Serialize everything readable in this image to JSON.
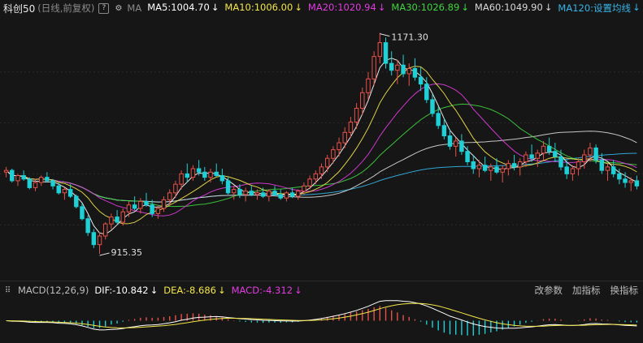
{
  "header": {
    "symbol": "科创50",
    "period_note": "(日线,前复权)",
    "help_icon": "help-icon",
    "settings_icon": "gear-icon",
    "ma_label": "MA",
    "mas": [
      {
        "key": "ma5",
        "label": "MA5:1004.70",
        "color": "#ffffff",
        "arrow": "↓"
      },
      {
        "key": "ma10",
        "label": "MA10:1006.00",
        "color": "#f3e64a",
        "arrow": "↓"
      },
      {
        "key": "ma20",
        "label": "MA20:1020.94",
        "color": "#e03ce0",
        "arrow": "↓"
      },
      {
        "key": "ma30",
        "label": "MA30:1026.89",
        "color": "#3fd43f",
        "arrow": "↓"
      },
      {
        "key": "ma60",
        "label": "MA60:1049.90",
        "color": "#d8d8d8",
        "arrow": "↓"
      },
      {
        "key": "ma120",
        "label": "MA120:设置均线",
        "color": "#35b5e8",
        "arrow": "↓"
      }
    ]
  },
  "macd_header": {
    "collapse_icon": "grid-dots-icon",
    "label": "MACD(12,26,9)",
    "dif": "DIF:-10.842",
    "dea": "DEA:-8.686",
    "macd": "MACD:-4.312",
    "arrow": "↓",
    "links": [
      "改参数",
      "加指标",
      "换指标"
    ]
  },
  "colors": {
    "up": "#e8514a",
    "down": "#1fd0d6",
    "dif": "#ffffff",
    "dea": "#f3e64a",
    "macd_label": "#e03ce0"
  },
  "chart_data": {
    "type": "candlestick",
    "ylim": [
      890,
      1185
    ],
    "high_label": "1171.30",
    "low_label": "915.35",
    "high_value": 1171.3,
    "low_value": 915.35,
    "ohlc": [
      [
        1010,
        1016,
        1004,
        1012
      ],
      [
        1012,
        1014,
        998,
        1000
      ],
      [
        1000,
        1008,
        994,
        1006
      ],
      [
        1006,
        1012,
        1000,
        1002
      ],
      [
        1002,
        1004,
        990,
        992
      ],
      [
        992,
        1002,
        988,
        998
      ],
      [
        998,
        1006,
        994,
        1004
      ],
      [
        1004,
        1010,
        998,
        1000
      ],
      [
        1000,
        1002,
        990,
        994
      ],
      [
        994,
        998,
        984,
        986
      ],
      [
        986,
        992,
        978,
        990
      ],
      [
        990,
        996,
        980,
        982
      ],
      [
        982,
        984,
        968,
        970
      ],
      [
        970,
        974,
        954,
        956
      ],
      [
        956,
        960,
        936,
        940
      ],
      [
        940,
        944,
        922,
        926
      ],
      [
        926,
        940,
        915.35,
        936
      ],
      [
        936,
        952,
        932,
        950
      ],
      [
        950,
        962,
        944,
        958
      ],
      [
        958,
        966,
        950,
        952
      ],
      [
        952,
        968,
        948,
        964
      ],
      [
        964,
        976,
        958,
        972
      ],
      [
        972,
        982,
        966,
        968
      ],
      [
        968,
        980,
        962,
        976
      ],
      [
        976,
        986,
        970,
        972
      ],
      [
        972,
        978,
        958,
        962
      ],
      [
        962,
        972,
        956,
        968
      ],
      [
        968,
        982,
        964,
        978
      ],
      [
        978,
        990,
        972,
        986
      ],
      [
        986,
        1000,
        980,
        996
      ],
      [
        996,
        1012,
        990,
        1008
      ],
      [
        1008,
        1020,
        998,
        1004
      ],
      [
        1004,
        1018,
        1000,
        1014
      ],
      [
        1014,
        1024,
        1006,
        1010
      ],
      [
        1010,
        1016,
        1000,
        1004
      ],
      [
        1004,
        1014,
        998,
        1010
      ],
      [
        1010,
        1020,
        1004,
        1006
      ],
      [
        1006,
        1014,
        996,
        1000
      ],
      [
        1000,
        1004,
        984,
        986
      ],
      [
        986,
        994,
        978,
        990
      ],
      [
        990,
        996,
        980,
        984
      ],
      [
        984,
        992,
        976,
        988
      ],
      [
        988,
        994,
        982,
        984
      ],
      [
        984,
        990,
        978,
        986
      ],
      [
        986,
        992,
        980,
        982
      ],
      [
        982,
        990,
        976,
        988
      ],
      [
        988,
        994,
        982,
        984
      ],
      [
        984,
        990,
        978,
        980
      ],
      [
        980,
        988,
        976,
        986
      ],
      [
        986,
        992,
        980,
        982
      ],
      [
        982,
        990,
        978,
        988
      ],
      [
        988,
        998,
        984,
        994
      ],
      [
        994,
        1006,
        990,
        1002
      ],
      [
        1002,
        1012,
        996,
        1008
      ],
      [
        1008,
        1020,
        1002,
        1016
      ],
      [
        1016,
        1030,
        1010,
        1026
      ],
      [
        1026,
        1040,
        1020,
        1036
      ],
      [
        1036,
        1050,
        1028,
        1044
      ],
      [
        1044,
        1062,
        1038,
        1056
      ],
      [
        1056,
        1074,
        1050,
        1068
      ],
      [
        1068,
        1090,
        1060,
        1084
      ],
      [
        1084,
        1108,
        1076,
        1102
      ],
      [
        1102,
        1126,
        1094,
        1118
      ],
      [
        1118,
        1150,
        1110,
        1144
      ],
      [
        1144,
        1171.3,
        1136,
        1160
      ],
      [
        1160,
        1166,
        1130,
        1136
      ],
      [
        1136,
        1150,
        1122,
        1128
      ],
      [
        1128,
        1140,
        1112,
        1134
      ],
      [
        1134,
        1146,
        1120,
        1124
      ],
      [
        1124,
        1136,
        1110,
        1130
      ],
      [
        1130,
        1142,
        1116,
        1120
      ],
      [
        1120,
        1132,
        1104,
        1112
      ],
      [
        1112,
        1120,
        1090,
        1094
      ],
      [
        1094,
        1100,
        1074,
        1078
      ],
      [
        1078,
        1086,
        1060,
        1064
      ],
      [
        1064,
        1072,
        1048,
        1052
      ],
      [
        1052,
        1060,
        1036,
        1040
      ],
      [
        1040,
        1050,
        1028,
        1046
      ],
      [
        1046,
        1054,
        1030,
        1034
      ],
      [
        1034,
        1040,
        1018,
        1022
      ],
      [
        1022,
        1030,
        1008,
        1014
      ],
      [
        1014,
        1024,
        1004,
        1018
      ],
      [
        1018,
        1028,
        1010,
        1012
      ],
      [
        1012,
        1020,
        1000,
        1016
      ],
      [
        1016,
        1026,
        1008,
        1010
      ],
      [
        1010,
        1018,
        998,
        1014
      ],
      [
        1014,
        1024,
        1006,
        1020
      ],
      [
        1020,
        1030,
        1012,
        1016
      ],
      [
        1016,
        1026,
        1006,
        1022
      ],
      [
        1022,
        1034,
        1016,
        1030
      ],
      [
        1030,
        1042,
        1022,
        1026
      ],
      [
        1026,
        1036,
        1016,
        1032
      ],
      [
        1032,
        1046,
        1024,
        1040
      ],
      [
        1040,
        1050,
        1030,
        1034
      ],
      [
        1034,
        1044,
        1022,
        1028
      ],
      [
        1028,
        1036,
        1012,
        1016
      ],
      [
        1016,
        1024,
        1002,
        1008
      ],
      [
        1008,
        1018,
        1000,
        1014
      ],
      [
        1014,
        1026,
        1006,
        1022
      ],
      [
        1022,
        1036,
        1014,
        1030
      ],
      [
        1030,
        1044,
        1022,
        1038
      ],
      [
        1038,
        1042,
        1020,
        1024
      ],
      [
        1024,
        1032,
        1008,
        1012
      ],
      [
        1012,
        1020,
        1000,
        1016
      ],
      [
        1016,
        1024,
        1004,
        1008
      ],
      [
        1008,
        1014,
        996,
        1002
      ],
      [
        1002,
        1010,
        992,
        998
      ],
      [
        998,
        1004,
        988,
        1000
      ],
      [
        1000,
        1006,
        990,
        994
      ]
    ],
    "ma5": [
      1004.7
    ],
    "ma10": [
      1006.0
    ],
    "ma20": [
      1020.94
    ],
    "ma30": [
      1026.89
    ],
    "ma60": [
      1049.9
    ],
    "macd_ylim": [
      -40,
      40
    ]
  }
}
